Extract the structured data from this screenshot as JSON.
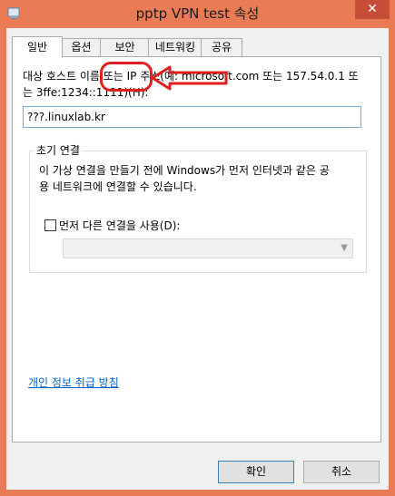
{
  "window": {
    "title": "pptp VPN test 속성",
    "close_glyph": "✕"
  },
  "tabs": [
    "일반",
    "옵션",
    "보안",
    "네트워킹",
    "공유"
  ],
  "general": {
    "host_label_line1": "대상 호스트 이름 또는 IP 주소(예: microsoft.com 또는 157.54.0.1 또",
    "host_label_line2": "는 3ffe:1234::1111)(H):",
    "host_value": "???.linuxlab.kr",
    "initial_connection_title": "초기 연결",
    "initial_connection_desc_line1": "이 가상 연결을 만들기 전에 Windows가 먼저 인터넷과 같은 공",
    "initial_connection_desc_line2": "용 네트워크에 연결할 수 있습니다.",
    "dial_first_label": "먼저 다른 연결을 사용(D):",
    "dial_first_checked": false,
    "connection_select_value": ""
  },
  "privacy_link": "개인 정보 취급 방침",
  "buttons": {
    "ok": "확인",
    "cancel": "취소"
  },
  "colors": {
    "frame": "#e97c55",
    "annotation": "#e02020",
    "link": "#0066cc"
  },
  "icons": {
    "window": "network-connection-icon",
    "select_arrow": "chevron-down-icon"
  }
}
